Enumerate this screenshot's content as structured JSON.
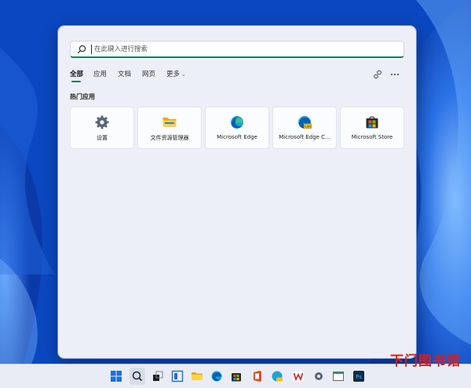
{
  "search": {
    "placeholder": "在此键入进行搜索"
  },
  "tabs": [
    {
      "label": "全部"
    },
    {
      "label": "应用"
    },
    {
      "label": "文档"
    },
    {
      "label": "网页"
    },
    {
      "label": "更多"
    }
  ],
  "section": {
    "title": "热门应用"
  },
  "tiles": [
    {
      "label": "设置",
      "icon": "gear-icon"
    },
    {
      "label": "文件资源管理器",
      "icon": "folder-icon"
    },
    {
      "label": "Microsoft Edge",
      "icon": "edge-icon"
    },
    {
      "label": "Microsoft Edge C...",
      "icon": "edge-canary-icon"
    },
    {
      "label": "Microsoft Store",
      "icon": "store-icon"
    }
  ],
  "watermark": {
    "text": "下门图书馆"
  },
  "colors": {
    "accent": "#1f7a5a",
    "wallpaper": "#0a49c4",
    "panel": "#eceff7"
  }
}
